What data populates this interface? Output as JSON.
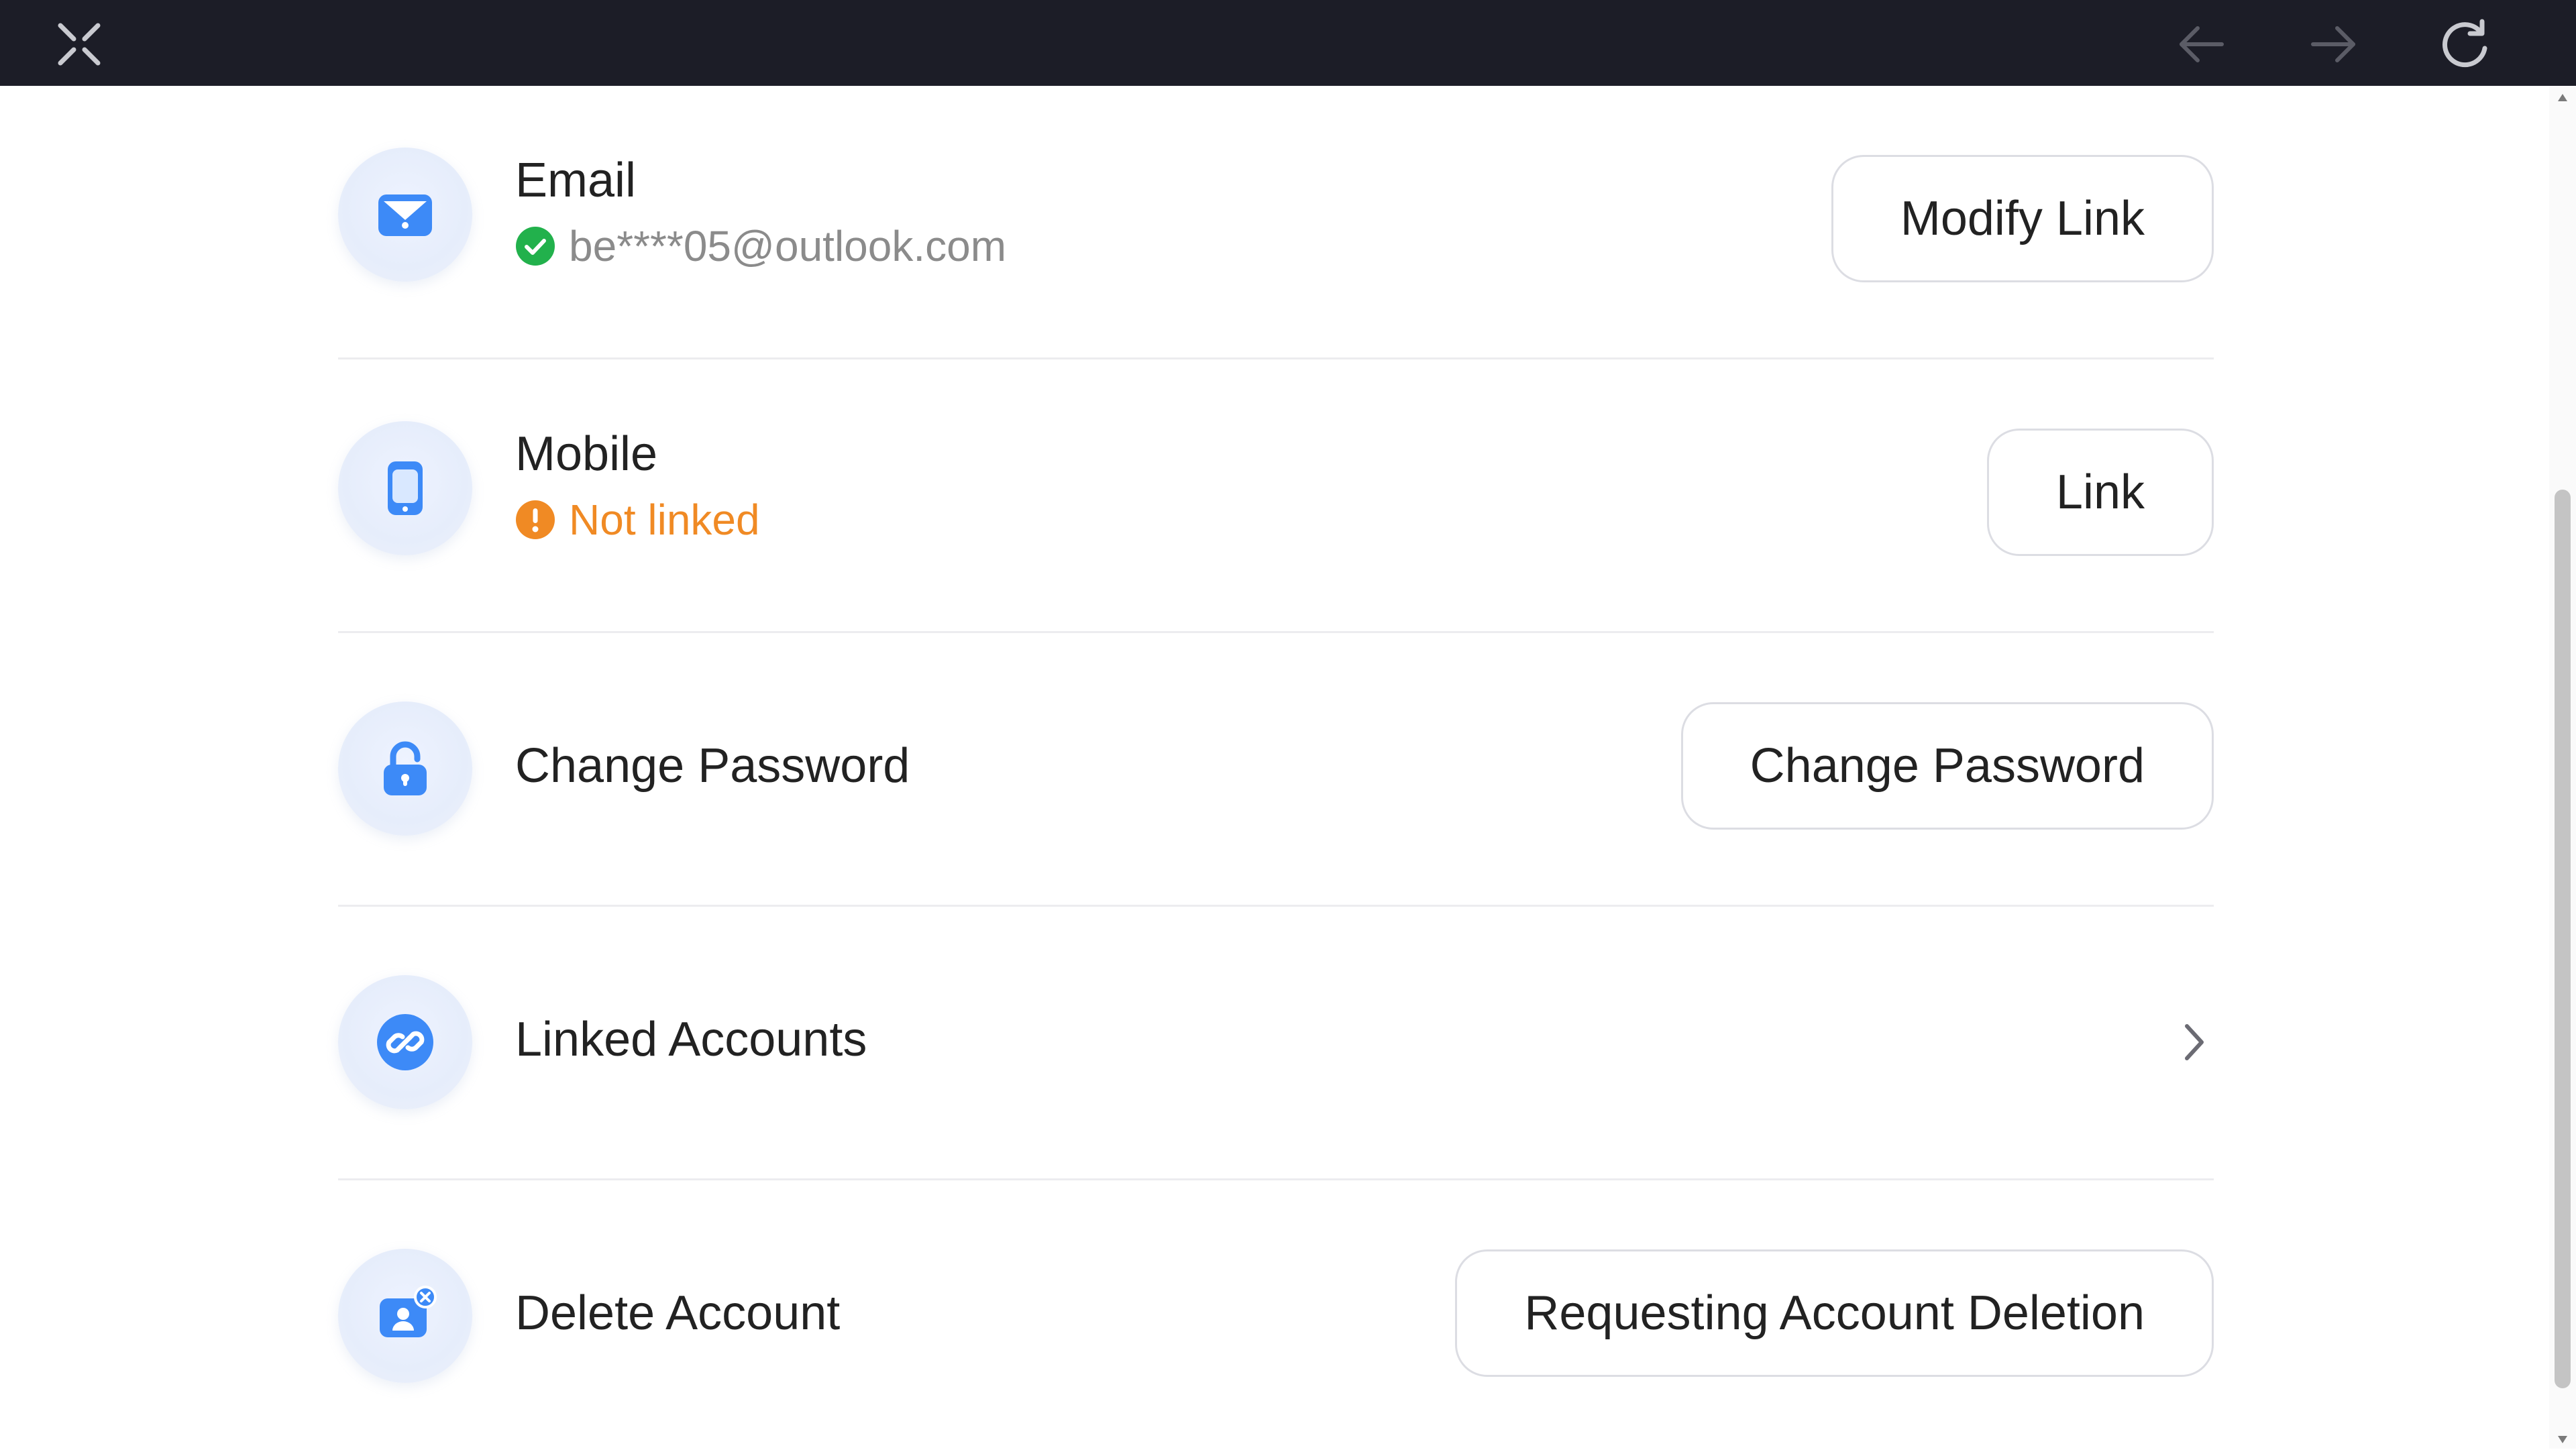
{
  "toolbar": {
    "close_icon": "close-icon",
    "back_icon": "arrow-left-icon",
    "forward_icon": "arrow-right-icon",
    "reload_icon": "reload-icon"
  },
  "rows": [
    {
      "icon": "email-icon",
      "title": "Email",
      "status_icon": "check-circle-icon",
      "status_text": "be****05@outlook.com",
      "button_label": "Modify Link"
    },
    {
      "icon": "mobile-icon",
      "title": "Mobile",
      "status_icon": "warning-circle-icon",
      "status_text": "Not linked",
      "button_label": "Link"
    },
    {
      "icon": "lock-icon",
      "title": "Change Password",
      "button_label": "Change Password"
    },
    {
      "icon": "link-icon",
      "title": "Linked Accounts",
      "action_icon": "chevron-right-icon"
    },
    {
      "icon": "delete-account-icon",
      "title": "Delete Account",
      "button_label": "Requesting Account Deletion"
    }
  ],
  "colors": {
    "topbar_bg": "#1c1d27",
    "accent_blue": "#3d8af7",
    "success_green": "#22b14c",
    "warning_orange": "#f08a24",
    "divider": "#ececef"
  }
}
